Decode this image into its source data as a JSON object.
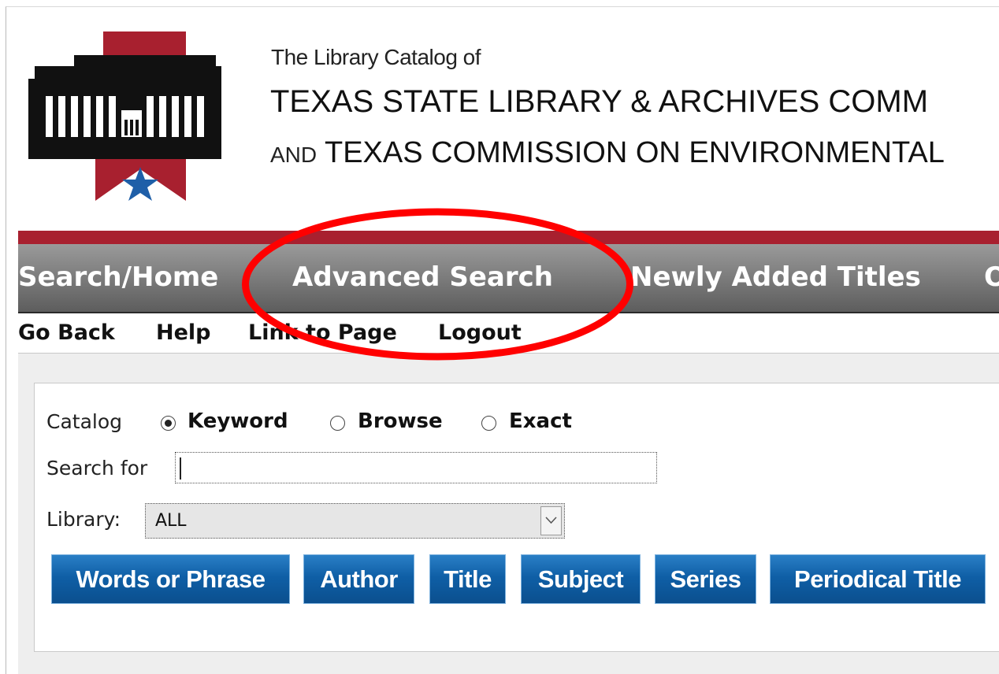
{
  "header": {
    "catalog_of": "The Library Catalog of",
    "line1": "TEXAS STATE LIBRARY & ARCHIVES COMM",
    "line2_and": "AND",
    "line2_rest": "TEXAS COMMISSION ON ENVIRONMENTAL"
  },
  "main_nav": {
    "items": [
      {
        "label": "Search/Home"
      },
      {
        "label": "Advanced Search"
      },
      {
        "label": "Newly Added Titles"
      },
      {
        "label": "O"
      }
    ]
  },
  "sub_nav": {
    "items": [
      {
        "label": "Go Back"
      },
      {
        "label": "Help"
      },
      {
        "label": "Link to Page"
      },
      {
        "label": "Logout"
      }
    ]
  },
  "search_form": {
    "catalog_label": "Catalog",
    "options": [
      {
        "label": "Keyword",
        "checked": true
      },
      {
        "label": "Browse",
        "checked": false
      },
      {
        "label": "Exact",
        "checked": false
      }
    ],
    "search_for_label": "Search for",
    "search_value": "",
    "library_label": "Library:",
    "library_selected": "ALL",
    "buttons": [
      {
        "label": "Words or Phrase"
      },
      {
        "label": "Author"
      },
      {
        "label": "Title"
      },
      {
        "label": "Subject"
      },
      {
        "label": "Series"
      },
      {
        "label": "Periodical Title"
      }
    ]
  },
  "colors": {
    "brand_red": "#a8202f",
    "nav_gray": "#6e6e6e",
    "button_blue": "#0f5fa6",
    "highlight_red": "#ff0000",
    "star_blue": "#1f5fa8"
  },
  "icons": {
    "logo": "library-building-logo",
    "dropdown": "chevron-down-icon"
  }
}
